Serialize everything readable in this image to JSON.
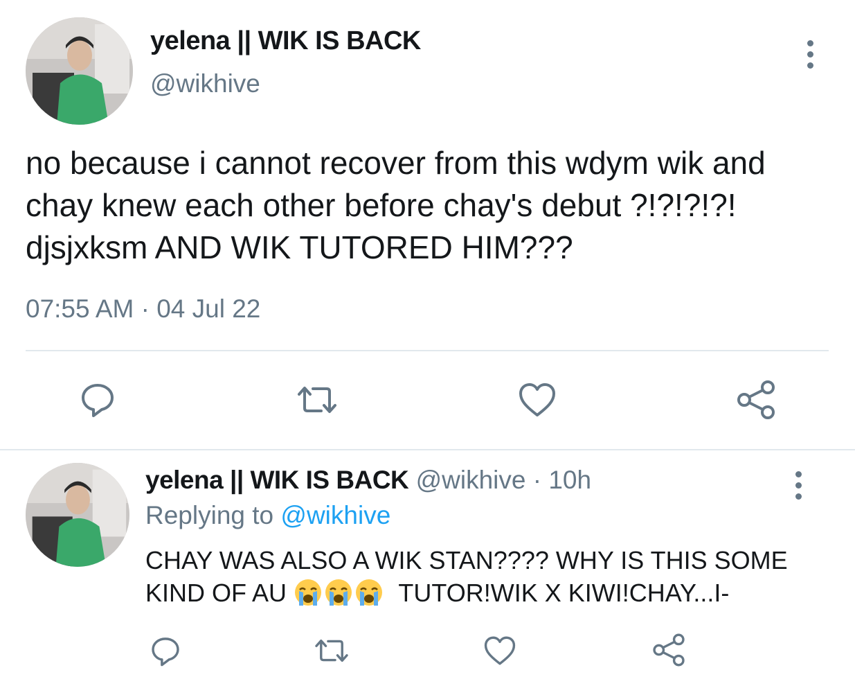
{
  "main_tweet": {
    "display_name": "yelena || WIK IS BACK",
    "handle": "@wikhive",
    "text": "no because i cannot recover from this wdym wik and chay knew each other before chay's debut ?!?!?!?! djsjxksm AND WIK TUTORED HIM???",
    "timestamp": "07:55 AM · 04 Jul 22",
    "actions": [
      "reply-icon",
      "retweet-icon",
      "like-icon",
      "share-icon"
    ]
  },
  "reply_tweet": {
    "display_name": "yelena || WIK IS BACK",
    "handle": "@wikhive",
    "separator": " · ",
    "time": "10h",
    "replying_label": "Replying to ",
    "replying_handle": "@wikhive",
    "text_before_emoji": "CHAY WAS ALSO A WIK STAN???? WHY IS THIS SOME KIND OF AU ",
    "text_after_emoji": "  TUTOR!WIK X KIWI!CHAY...I-",
    "emoji": [
      "loudly-crying-face-icon",
      "loudly-crying-face-icon",
      "loudly-crying-face-icon"
    ],
    "actions": [
      "reply-icon",
      "retweet-icon",
      "like-icon",
      "share-icon"
    ]
  },
  "colors": {
    "text": "#14171a",
    "secondary": "#657786",
    "link": "#1da1f2",
    "divider": "#e1e8ed",
    "avatar_jacket": "#3aa86a"
  }
}
